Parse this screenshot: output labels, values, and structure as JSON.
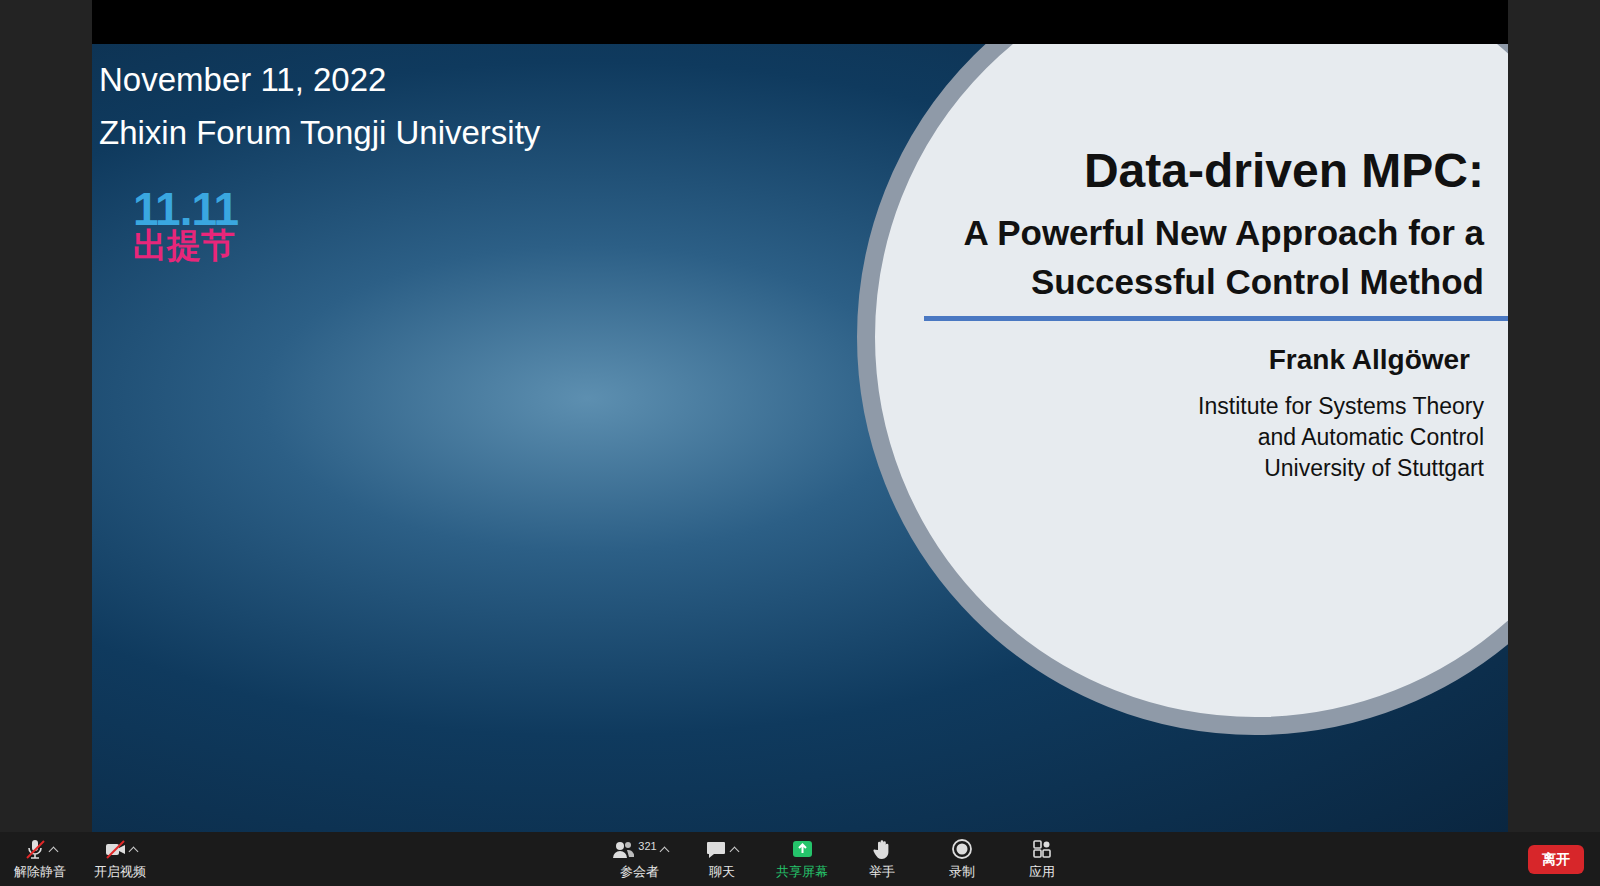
{
  "slide": {
    "date": "November 11, 2022",
    "venue": "Zhixin Forum Tongji University",
    "logo": {
      "number": "11.11",
      "label": "出提节"
    },
    "title": "Data-driven MPC:",
    "subtitle_lines": [
      "A Powerful New Approach for a",
      "Successful Control Method"
    ],
    "author": "Frank Allgöwer",
    "affiliation_lines": [
      "Institute for Systems Theory",
      "and Automatic Control",
      "University of Stuttgart"
    ]
  },
  "toolbar": {
    "left": [
      {
        "label": "解除静音",
        "kind": "mic",
        "off": true,
        "menu": true
      },
      {
        "label": "开启视频",
        "kind": "video",
        "off": true,
        "menu": true
      }
    ],
    "center": [
      {
        "label": "参会者",
        "kind": "participants",
        "count": "321",
        "menu": true,
        "active": false
      },
      {
        "label": "聊天",
        "kind": "chat",
        "menu": true,
        "active": false
      },
      {
        "label": "共享屏幕",
        "kind": "share",
        "menu": false,
        "active": true
      },
      {
        "label": "举手",
        "kind": "hand",
        "menu": false,
        "active": false
      },
      {
        "label": "录制",
        "kind": "record",
        "menu": false,
        "active": false
      },
      {
        "label": "应用",
        "kind": "apps",
        "menu": false,
        "active": false
      }
    ],
    "leave": "离开"
  }
}
